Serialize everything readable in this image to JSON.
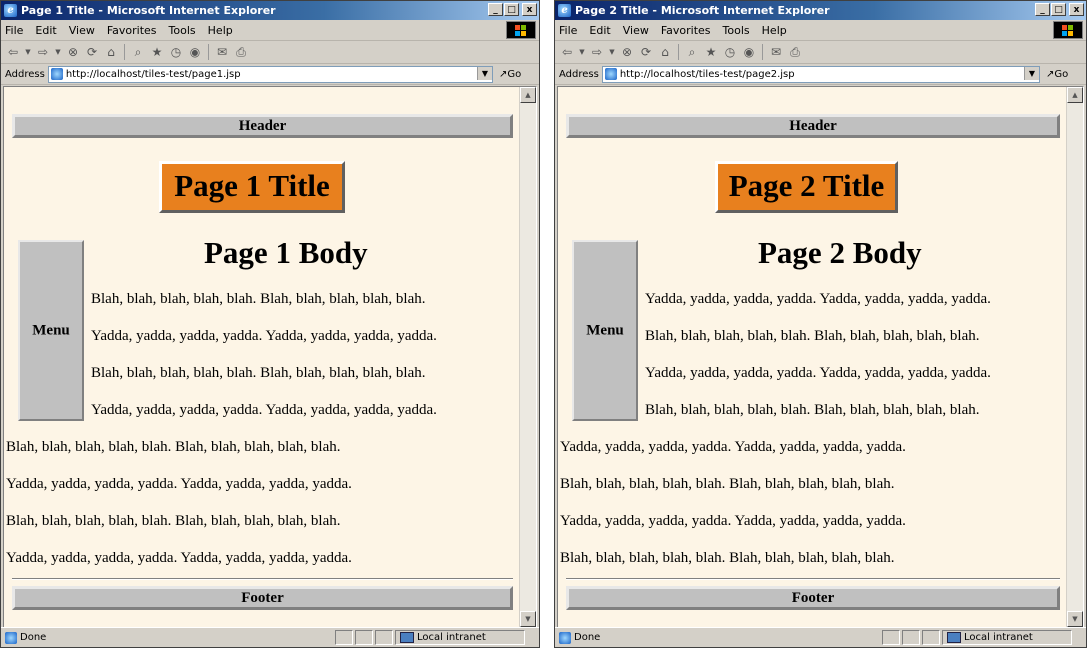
{
  "windows": [
    {
      "title": "Page 1 Title - Microsoft Internet Explorer",
      "menu": [
        "File",
        "Edit",
        "View",
        "Favorites",
        "Tools",
        "Help"
      ],
      "address_label": "Address",
      "url": "http://localhost/tiles-test/page1.jsp",
      "go_label": "Go",
      "page": {
        "header": "Header",
        "title": "Page 1 Title",
        "menu": "Menu",
        "body_heading": "Page 1 Body",
        "lines": [
          "Blah, blah, blah, blah, blah. Blah, blah, blah, blah, blah.",
          "Yadda, yadda, yadda, yadda. Yadda, yadda, yadda, yadda.",
          "Blah, blah, blah, blah, blah. Blah, blah, blah, blah, blah.",
          "Yadda, yadda, yadda, yadda. Yadda, yadda, yadda, yadda.",
          "Blah, blah, blah, blah, blah. Blah, blah, blah, blah, blah.",
          "Yadda, yadda, yadda, yadda. Yadda, yadda, yadda, yadda.",
          "Blah, blah, blah, blah, blah. Blah, blah, blah, blah, blah.",
          "Yadda, yadda, yadda, yadda. Yadda, yadda, yadda, yadda."
        ],
        "footer": "Footer"
      },
      "status_text": "Done",
      "zone": "Local intranet"
    },
    {
      "title": "Page 2 Title - Microsoft Internet Explorer",
      "menu": [
        "File",
        "Edit",
        "View",
        "Favorites",
        "Tools",
        "Help"
      ],
      "address_label": "Address",
      "url": "http://localhost/tiles-test/page2.jsp",
      "go_label": "Go",
      "page": {
        "header": "Header",
        "title": "Page 2 Title",
        "menu": "Menu",
        "body_heading": "Page 2 Body",
        "lines": [
          "Yadda, yadda, yadda, yadda. Yadda, yadda, yadda, yadda.",
          "Blah, blah, blah, blah, blah. Blah, blah, blah, blah, blah.",
          "Yadda, yadda, yadda, yadda. Yadda, yadda, yadda, yadda.",
          "Blah, blah, blah, blah, blah. Blah, blah, blah, blah, blah.",
          "Yadda, yadda, yadda, yadda. Yadda, yadda, yadda, yadda.",
          "Blah, blah, blah, blah, blah. Blah, blah, blah, blah, blah.",
          "Yadda, yadda, yadda, yadda. Yadda, yadda, yadda, yadda.",
          "Blah, blah, blah, blah, blah. Blah, blah, blah, blah, blah."
        ],
        "footer": "Footer"
      },
      "status_text": "Done",
      "zone": "Local intranet"
    }
  ],
  "colors": {
    "page_background": "#fdf5e6",
    "title_box": "#e8801e",
    "panel_gray": "#c0c0c0",
    "titlebar_blue": "#0a246a"
  },
  "icons": {
    "toolbar": [
      "back-icon",
      "forward-icon",
      "stop-icon",
      "refresh-icon",
      "home-icon",
      "search-icon",
      "favorites-icon",
      "history-icon",
      "mail-icon",
      "print-icon"
    ],
    "window_controls": [
      "minimize-icon",
      "maximize-icon",
      "close-icon"
    ]
  }
}
